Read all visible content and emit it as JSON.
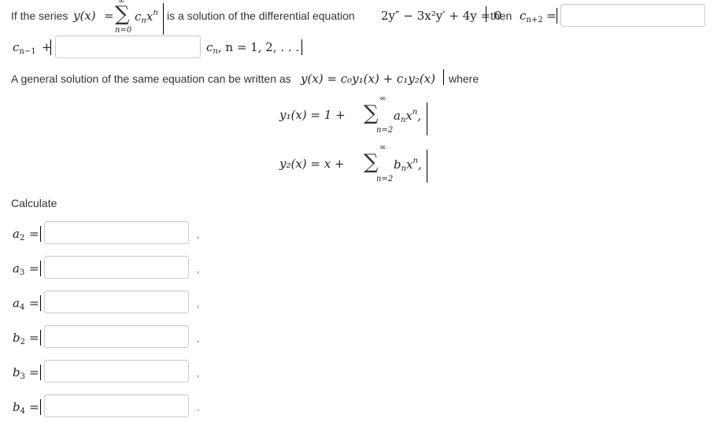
{
  "line1": {
    "prefix": "If the series",
    "series_lhs": "y(x)",
    "eq": "=",
    "sigma": "∑",
    "upper": "∞",
    "lower": "n=0",
    "term_base": "c",
    "term_sub": "n",
    "term_var": "x",
    "term_exp": "n",
    "middle": "is a solution of the differential equation",
    "equation": "2y″ − 3x²y′ + 4y = 0",
    "then": "then",
    "target_base": "c",
    "target_sub": "n+2",
    "target_eq": "="
  },
  "line2": {
    "lead_base": "c",
    "lead_sub": "n−1",
    "lead_plus": "+",
    "tail_base": "c",
    "tail_sub": "n",
    "tail_rest": ", n = 1, 2, . . ."
  },
  "line3": {
    "prefix": "A general solution of the same equation can be written as",
    "formula": "y(x) = c₀y₁(x) + c₁y₂(x)",
    "suffix": "where"
  },
  "y1": {
    "lhs": "y₁(x) = 1 +",
    "sigma": "∑",
    "upper": "∞",
    "lower": "n=2",
    "coef": "a",
    "coef_sub": "n",
    "var": "x",
    "exp": "n",
    "comma": ","
  },
  "y2": {
    "lhs": "y₂(x) = x +",
    "sigma": "∑",
    "upper": "∞",
    "lower": "n=2",
    "coef": "b",
    "coef_sub": "n",
    "var": "x",
    "exp": "n",
    "comma": ","
  },
  "calculate_label": "Calculate",
  "answers": [
    {
      "base": "a",
      "sub": "2",
      "eq": "=",
      "punct": ",",
      "value": ""
    },
    {
      "base": "a",
      "sub": "3",
      "eq": "=",
      "punct": ",",
      "value": ""
    },
    {
      "base": "a",
      "sub": "4",
      "eq": "=",
      "punct": ",",
      "value": ""
    },
    {
      "base": "b",
      "sub": "2",
      "eq": "=",
      "punct": ",",
      "value": ""
    },
    {
      "base": "b",
      "sub": "3",
      "eq": "=",
      "punct": ",",
      "value": ""
    },
    {
      "base": "b",
      "sub": "4",
      "eq": "=",
      "punct": ".",
      "value": ""
    }
  ],
  "recurrence_inputs": {
    "top_value": "",
    "left_value": ""
  }
}
